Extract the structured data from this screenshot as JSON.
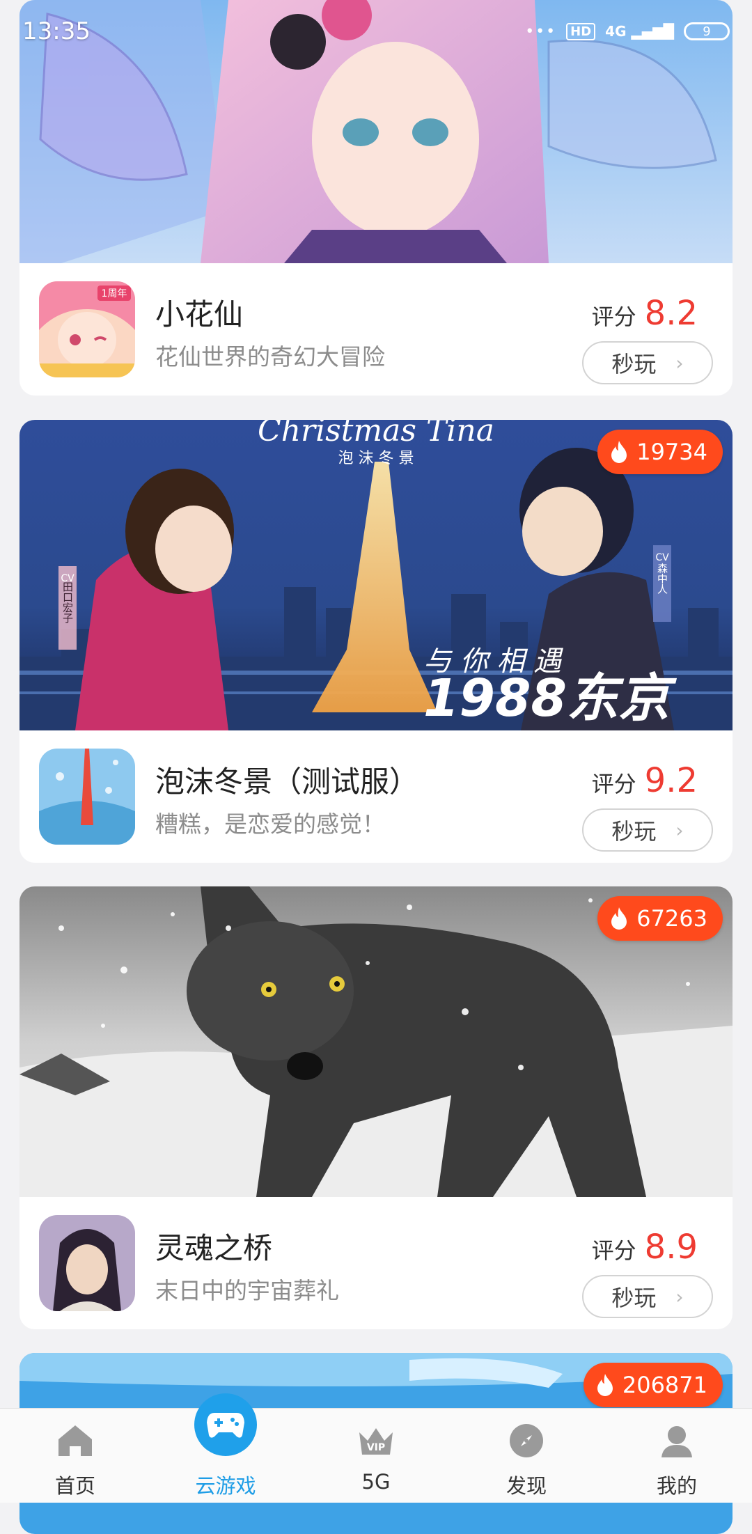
{
  "status_bar": {
    "time": "13:35",
    "network_badge": "HD",
    "signal": "4G",
    "battery": "9"
  },
  "games": [
    {
      "title": "小花仙",
      "subtitle": "花仙世界的奇幻大冒险",
      "rating_label": "评分",
      "rating": "8.2",
      "play_label": "秒玩",
      "hot_count": "",
      "icon_text": "1周年"
    },
    {
      "title": "泡沫冬景（测试服）",
      "subtitle": "糟糕，是恋爱的感觉！",
      "rating_label": "评分",
      "rating": "9.2",
      "play_label": "秒玩",
      "hot_count": "19734",
      "banner_texts": {
        "script": "Christmas Tina",
        "cn_title": "泡 沫 冬 景",
        "slogan_top": "与 你 相 遇",
        "slogan_main": "1988东京",
        "cv_left": "CV",
        "cv_left_name": "田口宏子",
        "cv_right": "CV",
        "cv_right_name": "森中人"
      }
    },
    {
      "title": "灵魂之桥",
      "subtitle": "末日中的宇宙葬礼",
      "rating_label": "评分",
      "rating": "8.9",
      "play_label": "秒玩",
      "hot_count": "67263"
    },
    {
      "title": "",
      "subtitle": "",
      "hot_count": "206871"
    }
  ],
  "tabs": [
    {
      "label": "首页",
      "icon": "home-icon"
    },
    {
      "label": "云游戏",
      "icon": "gamepad-icon",
      "active": true
    },
    {
      "label": "5G",
      "icon": "vip-crown-icon",
      "icon_text": "VIP"
    },
    {
      "label": "发现",
      "icon": "discover-icon"
    },
    {
      "label": "我的",
      "icon": "profile-icon"
    }
  ],
  "colors": {
    "accent": "#1fa0ea",
    "rating": "#ee3b32",
    "hot_badge": "#ff4a1c"
  }
}
